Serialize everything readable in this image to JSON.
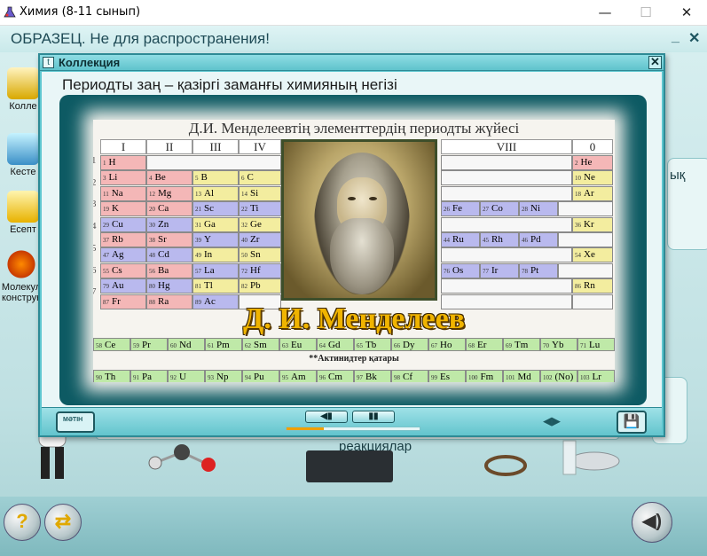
{
  "window": {
    "title": "Химия (8-11 сынып)",
    "minimize": "—",
    "maximize": "☐",
    "close": "✕"
  },
  "app": {
    "watermark": "ОБРАЗЕЦ. Не для распространения!",
    "min_btn": "_",
    "close_btn": "✕"
  },
  "sidebar": {
    "items": [
      {
        "label": "Колле",
        "icon": "h2o-collection-icon"
      },
      {
        "label": "Кесте",
        "icon": "table-icon"
      },
      {
        "label": "Есепт",
        "icon": "calculator-icon"
      },
      {
        "label": "Молекул конструк",
        "icon": "molecule-icon"
      }
    ]
  },
  "background": {
    "right_label": "ық",
    "reactions_label": "реакциялар"
  },
  "dialog": {
    "title": "Коллекция",
    "title_icon": "t",
    "close": "✕",
    "subtitle": "Периодты заң – қазіргі заманғы химияның негізі",
    "slide": {
      "heading": "Д.И. Менделеевтің элементтердің периодты жүйесі",
      "groups": [
        "I",
        "II",
        "III",
        "IV",
        "VIII",
        "0"
      ],
      "periods": [
        "1",
        "2",
        "3",
        "4",
        "5",
        "6",
        "7"
      ],
      "name": "Д. И. Менделеев",
      "actinides_label": "**Актинидтер қатары",
      "lanthanides_marker": "*"
    },
    "toolbar": {
      "keyboard_label": "МӘТІН",
      "prev_label": "◀▮",
      "pause_label": "▮▮",
      "nav_label": "◀▶",
      "save_label": "💾",
      "progress": 0.28
    }
  },
  "elements": {
    "left": [
      [
        {
          "n": "1",
          "s": "H",
          "t": "s"
        },
        {
          "n": "",
          "s": "",
          "t": "e"
        }
      ],
      [
        {
          "n": "3",
          "s": "Li",
          "t": "s"
        },
        {
          "n": "4",
          "s": "Be",
          "t": "s"
        },
        {
          "n": "5",
          "s": "B",
          "t": "p"
        },
        {
          "n": "6",
          "s": "C",
          "t": "p"
        }
      ],
      [
        {
          "n": "11",
          "s": "Na",
          "t": "s"
        },
        {
          "n": "12",
          "s": "Mg",
          "t": "s"
        },
        {
          "n": "13",
          "s": "Al",
          "t": "p"
        },
        {
          "n": "14",
          "s": "Si",
          "t": "p"
        }
      ],
      [
        {
          "n": "19",
          "s": "K",
          "t": "s"
        },
        {
          "n": "20",
          "s": "Ca",
          "t": "s"
        },
        {
          "n": "21",
          "s": "Sc",
          "t": "d"
        },
        {
          "n": "22",
          "s": "Ti",
          "t": "d"
        }
      ],
      [
        {
          "n": "29",
          "s": "Cu",
          "t": "d"
        },
        {
          "n": "30",
          "s": "Zn",
          "t": "d"
        },
        {
          "n": "31",
          "s": "Ga",
          "t": "p"
        },
        {
          "n": "32",
          "s": "Ge",
          "t": "p"
        }
      ],
      [
        {
          "n": "37",
          "s": "Rb",
          "t": "s"
        },
        {
          "n": "38",
          "s": "Sr",
          "t": "s"
        },
        {
          "n": "39",
          "s": "Y",
          "t": "d"
        },
        {
          "n": "40",
          "s": "Zr",
          "t": "d"
        }
      ],
      [
        {
          "n": "47",
          "s": "Ag",
          "t": "d"
        },
        {
          "n": "48",
          "s": "Cd",
          "t": "d"
        },
        {
          "n": "49",
          "s": "In",
          "t": "p"
        },
        {
          "n": "50",
          "s": "Sn",
          "t": "p"
        }
      ],
      [
        {
          "n": "55",
          "s": "Cs",
          "t": "s"
        },
        {
          "n": "56",
          "s": "Ba",
          "t": "s"
        },
        {
          "n": "57",
          "s": "La",
          "t": "d"
        },
        {
          "n": "72",
          "s": "Hf",
          "t": "d"
        }
      ],
      [
        {
          "n": "79",
          "s": "Au",
          "t": "d"
        },
        {
          "n": "80",
          "s": "Hg",
          "t": "d"
        },
        {
          "n": "81",
          "s": "Tl",
          "t": "p"
        },
        {
          "n": "82",
          "s": "Pb",
          "t": "p"
        }
      ],
      [
        {
          "n": "87",
          "s": "Fr",
          "t": "s"
        },
        {
          "n": "88",
          "s": "Ra",
          "t": "s"
        },
        {
          "n": "89",
          "s": "Ac",
          "t": "d"
        },
        {
          "n": "",
          "s": "",
          "t": "e"
        }
      ]
    ],
    "right": [
      {
        "row": 1,
        "cells": [
          {
            "n": "2",
            "s": "He",
            "t": "s"
          }
        ]
      },
      {
        "row": 2,
        "cells": [
          {
            "n": "10",
            "s": "Ne",
            "t": "p"
          }
        ]
      },
      {
        "row": 3,
        "cells": [
          {
            "n": "18",
            "s": "Ar",
            "t": "p"
          }
        ]
      },
      {
        "row": 4,
        "cells": [
          {
            "n": "26",
            "s": "Fe",
            "t": "d"
          },
          {
            "n": "27",
            "s": "Co",
            "t": "d"
          },
          {
            "n": "28",
            "s": "Ni",
            "t": "d"
          }
        ]
      },
      {
        "row": 5,
        "cells": [
          {
            "n": "36",
            "s": "Kr",
            "t": "p"
          }
        ]
      },
      {
        "row": 6,
        "cells": [
          {
            "n": "44",
            "s": "Ru",
            "t": "d"
          },
          {
            "n": "45",
            "s": "Rh",
            "t": "d"
          },
          {
            "n": "46",
            "s": "Pd",
            "t": "d"
          }
        ]
      },
      {
        "row": 7,
        "cells": [
          {
            "n": "54",
            "s": "Xe",
            "t": "p"
          }
        ]
      },
      {
        "row": 8,
        "cells": [
          {
            "n": "76",
            "s": "Os",
            "t": "d"
          },
          {
            "n": "77",
            "s": "Ir",
            "t": "d"
          },
          {
            "n": "78",
            "s": "Pt",
            "t": "d"
          }
        ]
      },
      {
        "row": 9,
        "cells": [
          {
            "n": "86",
            "s": "Rn",
            "t": "p"
          }
        ]
      },
      {
        "row": 10,
        "cells": [
          {
            "n": "",
            "s": "",
            "t": "e"
          }
        ]
      }
    ],
    "lanthanides": [
      {
        "n": "58",
        "s": "Ce"
      },
      {
        "n": "59",
        "s": "Pr"
      },
      {
        "n": "60",
        "s": "Nd"
      },
      {
        "n": "61",
        "s": "Pm"
      },
      {
        "n": "62",
        "s": "Sm"
      },
      {
        "n": "63",
        "s": "Eu"
      },
      {
        "n": "64",
        "s": "Gd"
      },
      {
        "n": "65",
        "s": "Tb"
      },
      {
        "n": "66",
        "s": "Dy"
      },
      {
        "n": "67",
        "s": "Ho"
      },
      {
        "n": "68",
        "s": "Er"
      },
      {
        "n": "69",
        "s": "Tm"
      },
      {
        "n": "70",
        "s": "Yb"
      },
      {
        "n": "71",
        "s": "Lu"
      }
    ],
    "actinides": [
      {
        "n": "90",
        "s": "Th"
      },
      {
        "n": "91",
        "s": "Pa"
      },
      {
        "n": "92",
        "s": "U"
      },
      {
        "n": "93",
        "s": "Np"
      },
      {
        "n": "94",
        "s": "Pu"
      },
      {
        "n": "95",
        "s": "Am"
      },
      {
        "n": "96",
        "s": "Cm"
      },
      {
        "n": "97",
        "s": "Bk"
      },
      {
        "n": "98",
        "s": "Cf"
      },
      {
        "n": "99",
        "s": "Es"
      },
      {
        "n": "100",
        "s": "Fm"
      },
      {
        "n": "101",
        "s": "Md"
      },
      {
        "n": "102",
        "s": "(No)"
      },
      {
        "n": "103",
        "s": "Lr"
      }
    ]
  },
  "colors": {
    "s_block": "#f4b7b7",
    "p_block": "#f3ed9f",
    "d_block": "#b9b9ee",
    "f_block": "#bfe9a8",
    "dialog": "#5ec6cf",
    "screen": "#0d5a63",
    "name": "#f0b400"
  }
}
